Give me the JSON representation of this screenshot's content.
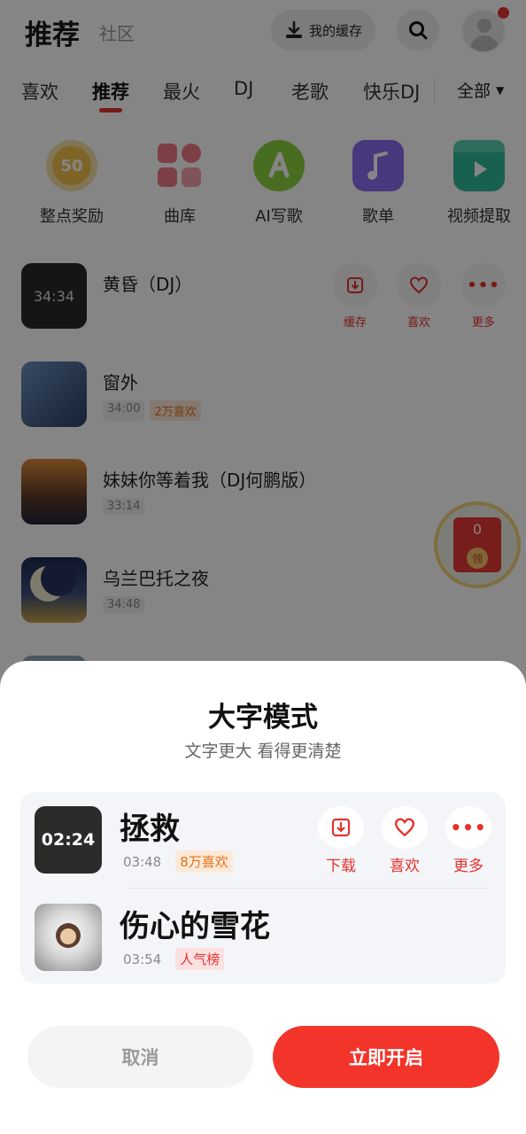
{
  "header": {
    "title": "推荐",
    "subtitle": "社区",
    "cache_label": "我的缓存"
  },
  "tabs": [
    "喜欢",
    "推荐",
    "最火",
    "DJ",
    "老歌",
    "快乐DJ"
  ],
  "active_tab": "推荐",
  "tab_all": "全部",
  "categories": [
    {
      "label": "整点奖励",
      "badge": "50"
    },
    {
      "label": "曲库"
    },
    {
      "label": "AI写歌"
    },
    {
      "label": "歌单"
    },
    {
      "label": "视频提取"
    }
  ],
  "songs": [
    {
      "title": "黄昏（DJ）",
      "cover_text": "34:34"
    },
    {
      "title": "窗外",
      "duration": "34:00",
      "likes": "2万喜欢"
    },
    {
      "title": "妹妹你等着我（DJ何鹏版）",
      "duration": "33:14"
    },
    {
      "title": "乌兰巴托之夜",
      "duration": "34:48"
    }
  ],
  "row_actions": {
    "cache": "缓存",
    "like": "喜欢",
    "more": "更多"
  },
  "float_badge": {
    "count": "0",
    "label": "领"
  },
  "sheet": {
    "title": "大字模式",
    "subtitle": "文字更大 看得更清楚",
    "preview": [
      {
        "title": "拯救",
        "cover_text": "02:24",
        "duration": "03:48",
        "tag": "8万喜欢"
      },
      {
        "title": "伤心的雪花",
        "duration": "03:54",
        "tag": "人气榜"
      }
    ],
    "actions": {
      "download": "下载",
      "like": "喜欢",
      "more": "更多"
    },
    "cancel_label": "取消",
    "confirm_label": "立即开启"
  },
  "colors": {
    "accent": "#f3342a",
    "orange": "#e0731f"
  }
}
